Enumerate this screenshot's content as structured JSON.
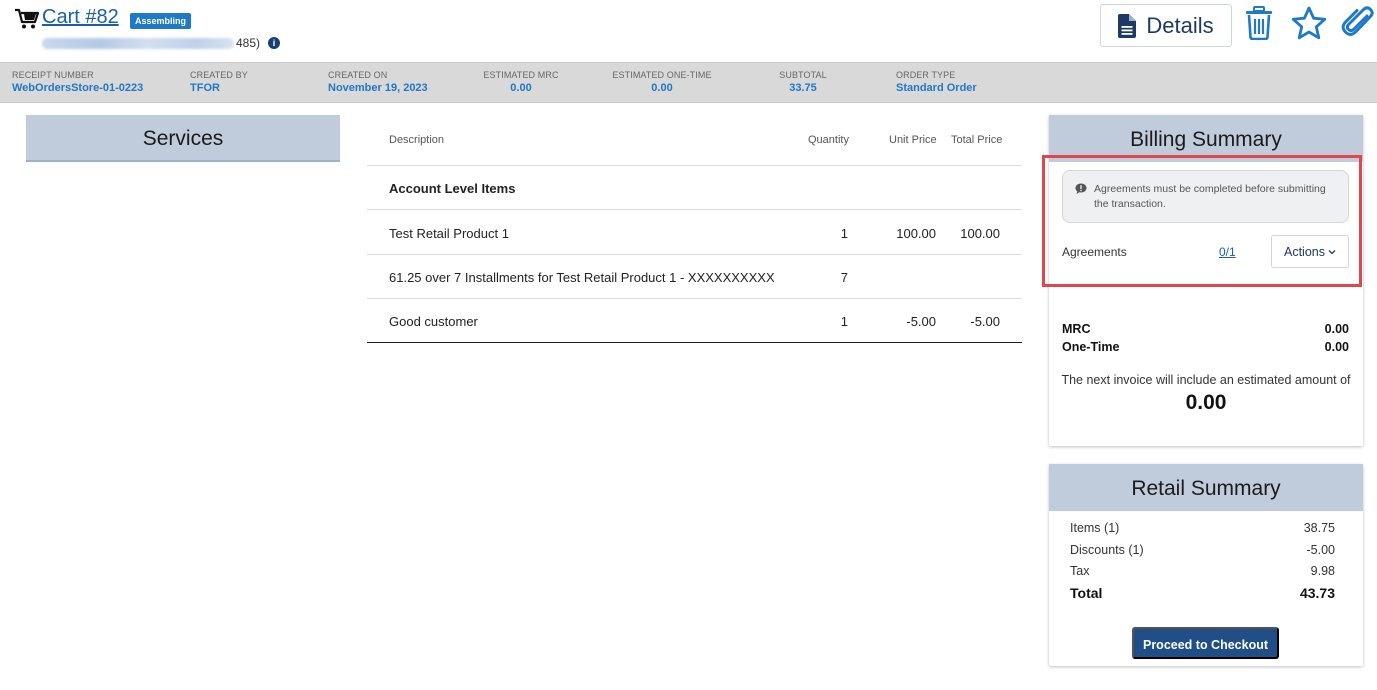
{
  "header": {
    "cart_title": "Cart #82",
    "status": "Assembling",
    "customer_suffix": "485)",
    "details_label": "Details"
  },
  "info_bar": [
    {
      "label": "RECEIPT NUMBER",
      "value": "WebOrdersStore-01-0223"
    },
    {
      "label": "CREATED BY",
      "value": "TFOR"
    },
    {
      "label": "CREATED ON",
      "value": "November 19, 2023"
    },
    {
      "label": "ESTIMATED MRC",
      "value": "0.00"
    },
    {
      "label": "ESTIMATED ONE-TIME",
      "value": "0.00"
    },
    {
      "label": "SUBTOTAL",
      "value": "33.75"
    },
    {
      "label": "ORDER TYPE",
      "value": "Standard Order"
    }
  ],
  "services": {
    "title": "Services"
  },
  "items": {
    "columns": {
      "description": "Description",
      "quantity": "Quantity",
      "unit_price": "Unit Price",
      "total_price": "Total Price"
    },
    "group_title": "Account Level Items",
    "rows": [
      {
        "description": "Test Retail Product 1",
        "quantity": "1",
        "unit_price": "100.00",
        "total_price": "100.00"
      },
      {
        "description": "61.25 over 7 Installments for Test Retail Product 1 - XXXXXXXXXX",
        "quantity": "7",
        "unit_price": "",
        "total_price": ""
      },
      {
        "description": "Good customer",
        "quantity": "1",
        "unit_price": "-5.00",
        "total_price": "-5.00"
      }
    ]
  },
  "billing": {
    "title": "Billing Summary",
    "warning": "Agreements must be completed before submitting the transaction.",
    "agreements_label": "Agreements",
    "agreements_count": "0/1",
    "actions_label": "Actions",
    "mrc_label": "MRC",
    "mrc_value": "0.00",
    "onetime_label": "One-Time",
    "onetime_value": "0.00",
    "next_invoice_text": "The next invoice will include an estimated amount of",
    "next_invoice_amount": "0.00"
  },
  "retail": {
    "title": "Retail Summary",
    "rows": [
      {
        "label": "Items (1)",
        "value": "38.75"
      },
      {
        "label": "Discounts (1)",
        "value": "-5.00"
      },
      {
        "label": "Tax",
        "value": "9.98"
      },
      {
        "label": "Total",
        "value": "43.73"
      }
    ],
    "checkout_label": "Proceed to Checkout"
  },
  "colors": {
    "accent_blue": "#1f78c8",
    "dark_blue": "#1f4f86",
    "panel_header": "#c0cbdc",
    "highlight_red": "#e0474c"
  }
}
